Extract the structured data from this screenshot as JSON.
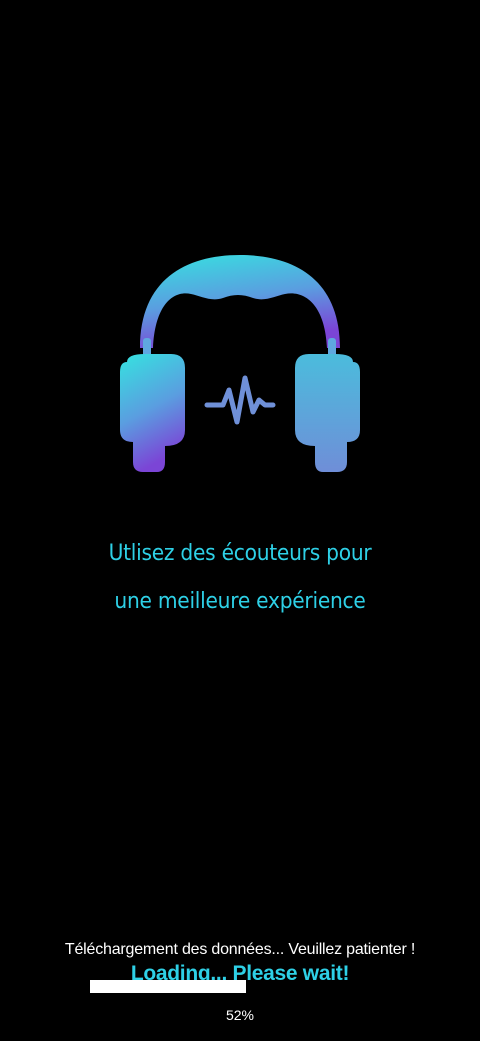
{
  "splash": {
    "logo_icon": "headphones-icon",
    "pulse_icon": "heartbeat-pulse-icon",
    "message_line1": "Utlisez des écouteurs pour",
    "message_line2": "une meilleure expérience",
    "accent_color": "#2ed0e6",
    "gradient_start": "#35e3e0",
    "gradient_end": "#7b45d6"
  },
  "loading": {
    "status_fr": "Téléchargement des données... Veuillez patienter !",
    "status_en": "Loading... Please wait!",
    "progress": 0.52,
    "percent_label": "52%"
  }
}
